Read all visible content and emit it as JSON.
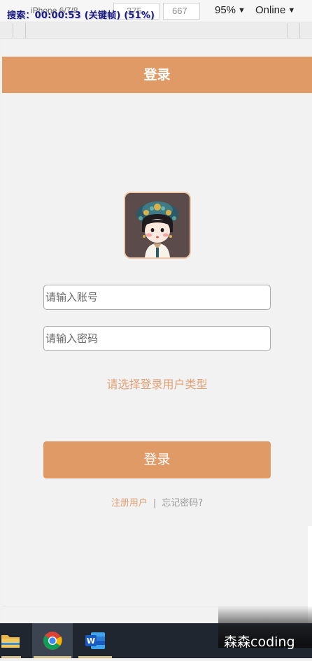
{
  "devtools": {
    "device_label": "iPhone 6/7/8",
    "width_value": "375",
    "dim_separator": "×",
    "height_value": "667",
    "zoom": "95%",
    "network": "Online",
    "recording_overlay": "搜索：00:00:53 (关键帧) (51%)"
  },
  "app": {
    "header_title": "登录",
    "avatar_icon": "empress-avatar",
    "account_placeholder": "请输入账号",
    "password_placeholder": "请输入密码",
    "user_type_prompt": "请选择登录用户类型",
    "login_button": "登录",
    "register_link": "注册用户",
    "separator": "|",
    "forgot_link": "忘记密码?"
  },
  "colors": {
    "accent": "#e09a66",
    "link": "#e0a074",
    "muted": "#999999",
    "taskbar": "#1f2630"
  },
  "taskbar": {
    "items": [
      "folder-icon",
      "chrome-icon",
      "word-icon"
    ]
  },
  "watermark": {
    "text": "森森coding"
  }
}
